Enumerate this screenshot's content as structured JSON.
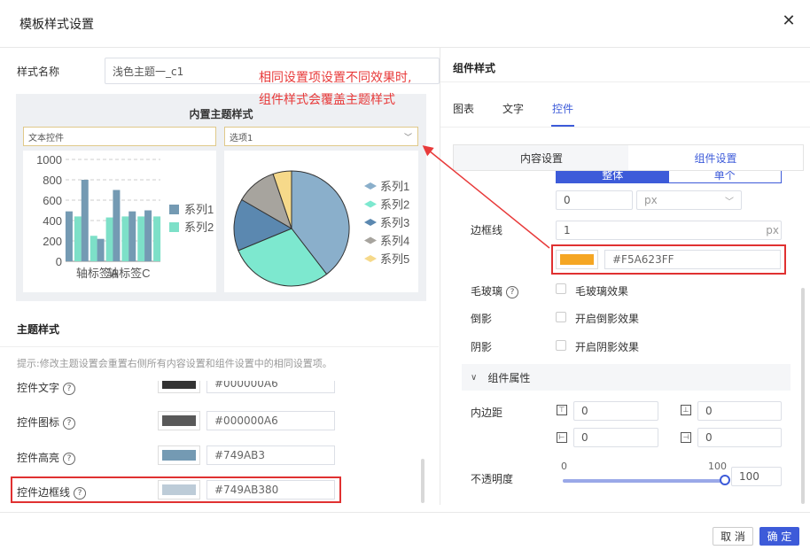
{
  "dialog": {
    "title": "模板样式设置",
    "close_icon": "close-icon"
  },
  "style_name": {
    "label": "样式名称",
    "value": "浅色主题一_c1"
  },
  "annotation": {
    "line1": "相同设置项设置不同效果时,",
    "line2": "组件样式会覆盖主题样式"
  },
  "preview": {
    "title": "内置主题样式",
    "text_control": "文本控件",
    "select_control": "选项1",
    "chart_data": [
      {
        "type": "bar",
        "categories": [
          "",
          "轴标签A",
          "",
          "轴标签C",
          "",
          ""
        ],
        "series": [
          {
            "name": "系列1",
            "values": [
              490,
              800,
              220,
              700,
              490,
              500
            ],
            "color": "#749AB3"
          },
          {
            "name": "系列2",
            "values": [
              440,
              250,
              430,
              440,
              440,
              440
            ],
            "color": "#7DE0C8"
          }
        ],
        "yticks": [
          "0",
          "200",
          "400",
          "600",
          "800",
          "1000"
        ],
        "ylim": [
          0,
          1000
        ]
      },
      {
        "type": "pie",
        "slices": [
          {
            "name": "系列1",
            "value": 38,
            "color": "#8AAFCB"
          },
          {
            "name": "系列2",
            "value": 28,
            "color": "#7DE8CF"
          },
          {
            "name": "系列3",
            "value": 14,
            "color": "#5B88B0"
          },
          {
            "name": "系列4",
            "value": 11,
            "color": "#A7A49E"
          },
          {
            "name": "系列5",
            "value": 5,
            "color": "#F6D98A"
          }
        ]
      }
    ]
  },
  "theme_style": {
    "heading": "主题样式",
    "tip": "提示:修改主题设置会重置右侧所有内容设置和组件设置中的相同设置项。",
    "rows": [
      {
        "label": "控件文字",
        "color": "#333333",
        "hex": "#000000A6"
      },
      {
        "label": "控件图标",
        "color": "#595959",
        "hex": "#000000A6"
      },
      {
        "label": "控件高亮",
        "color": "#749AB3",
        "hex": "#749AB3"
      },
      {
        "label": "控件边框线",
        "color": "#BDCCD8",
        "hex": "#749AB380"
      }
    ]
  },
  "component_style": {
    "heading": "组件样式",
    "tabs": [
      "图表",
      "文字",
      "控件"
    ],
    "active_tab": "控件",
    "subtabs": [
      "内容设置",
      "组件设置"
    ],
    "segment": [
      "整体",
      "单个"
    ],
    "width_value": "0",
    "width_unit": "px",
    "border": {
      "label": "边框线",
      "width": "1",
      "unit": "px",
      "color": "#F5A623",
      "hex": "#F5A623FF"
    },
    "frosted": {
      "label": "毛玻璃",
      "checkbox": "毛玻璃效果"
    },
    "reflection": {
      "label": "倒影",
      "checkbox": "开启倒影效果"
    },
    "shadow": {
      "label": "阴影",
      "checkbox": "开启阴影效果"
    },
    "props_heading": "组件属性",
    "padding": {
      "label": "内边距",
      "top": "0",
      "bottom": "0",
      "left": "0",
      "right": "0"
    },
    "opacity": {
      "label": "不透明度",
      "min": "0",
      "max": "100",
      "value": "100",
      "fraction": 1.0
    }
  },
  "footer": {
    "cancel": "取 消",
    "ok": "确 定"
  },
  "colors": {
    "accent": "#3D5BD9",
    "annotation": "#E83A3A"
  }
}
